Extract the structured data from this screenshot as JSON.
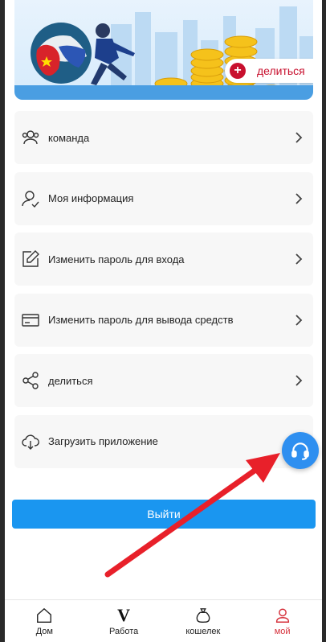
{
  "banner": {
    "share_label": "делиться"
  },
  "menu": {
    "items": [
      {
        "label": "команда",
        "icon": "team-icon"
      },
      {
        "label": "Моя информация",
        "icon": "user-check-icon"
      },
      {
        "label": "Изменить пароль для входа",
        "icon": "edit-icon"
      },
      {
        "label": "Изменить пароль для вывода средств",
        "icon": "card-icon"
      },
      {
        "label": "делиться",
        "icon": "share-icon"
      },
      {
        "label": "Загрузить приложение",
        "icon": "cloud-download-icon"
      }
    ]
  },
  "logout_label": "Выйти",
  "bottom_nav": {
    "items": [
      {
        "label": "Дом",
        "icon": "home-icon"
      },
      {
        "label": "Работа",
        "icon": "v-icon"
      },
      {
        "label": "кошелек",
        "icon": "wallet-bag-icon"
      },
      {
        "label": "мой",
        "icon": "profile-icon",
        "active": true
      }
    ]
  },
  "colors": {
    "primary": "#1a96f0",
    "accent": "#d6333d",
    "fab": "#2e8ff0",
    "annotation_arrow": "#e8202a"
  }
}
